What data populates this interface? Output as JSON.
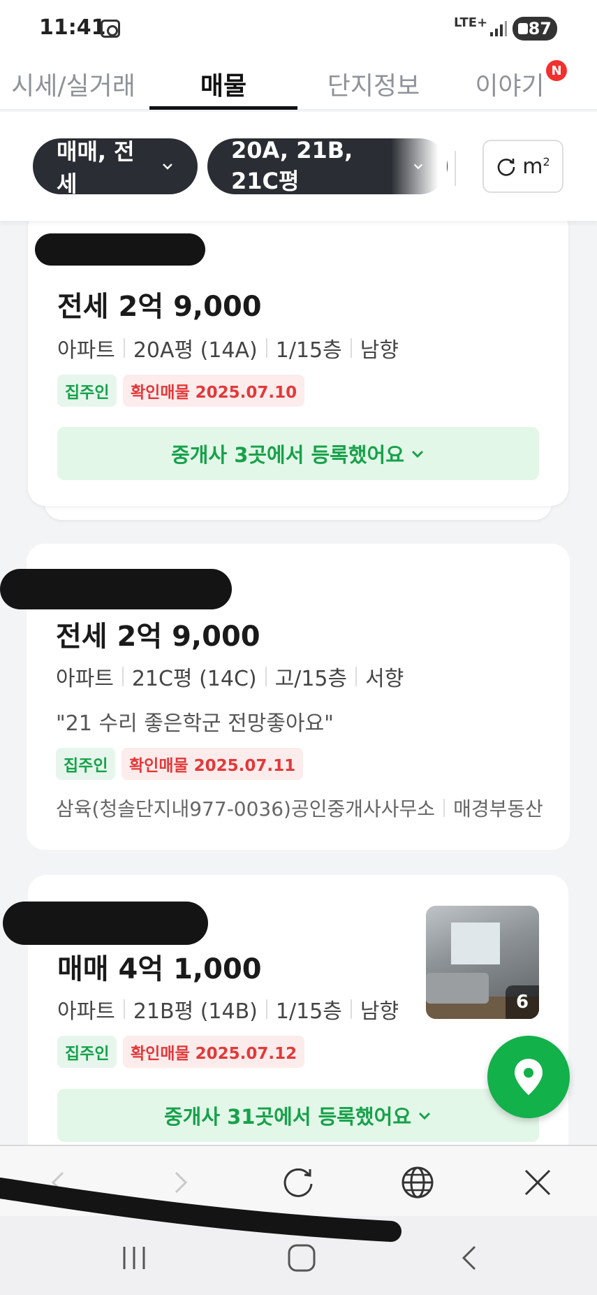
{
  "status_bar": {
    "time": "11:41",
    "network": "LTE+",
    "battery": "87"
  },
  "tabs": [
    {
      "label": "시세/실거래"
    },
    {
      "label": "매물"
    },
    {
      "label": "단지정보"
    },
    {
      "label": "이야기"
    }
  ],
  "tab_badge": "N",
  "filters": {
    "trade_type": "매매, 전세",
    "size": "20A, 21B, 21C평",
    "unit": "m",
    "unit_sup": "2"
  },
  "listings": [
    {
      "price": "전세 2억 9,000",
      "type": "아파트",
      "size": "20A평 (14A)",
      "floor": "1/15층",
      "direction": "남향",
      "owner_tag": "집주인",
      "verified_tag": "확인매물 2025.07.10",
      "agent_button": "중개사 3곳에서 등록했어요"
    },
    {
      "price": "전세 2억 9,000",
      "type": "아파트",
      "size": "21C평 (14C)",
      "floor": "고/15층",
      "direction": "서향",
      "quote": "\"21 수리 좋은학군 전망좋아요\"",
      "owner_tag": "집주인",
      "verified_tag": "확인매물 2025.07.11",
      "agency_primary": "삼육(청솔단지내977-0036)공인중개사사무소",
      "agency_secondary": "매경부동산"
    },
    {
      "price": "매매 4억 1,000",
      "type": "아파트",
      "size": "21B평 (14B)",
      "floor": "1/15층",
      "direction": "남향",
      "owner_tag": "집주인",
      "verified_tag": "확인매물 2025.07.12",
      "photo_count": "6",
      "agent_button": "중개사 31곳에서 등록했어요"
    }
  ],
  "colors": {
    "accent_green": "#17a14b",
    "fab_green": "#12b14a",
    "verified_red": "#e2393a",
    "chip_dark": "#2a2d33"
  },
  "icons": {
    "fab": "map-pin-icon",
    "browser": [
      "back-icon",
      "forward-icon",
      "reload-icon",
      "globe-icon",
      "close-icon"
    ],
    "system": [
      "recents-icon",
      "home-icon",
      "back-icon"
    ]
  }
}
